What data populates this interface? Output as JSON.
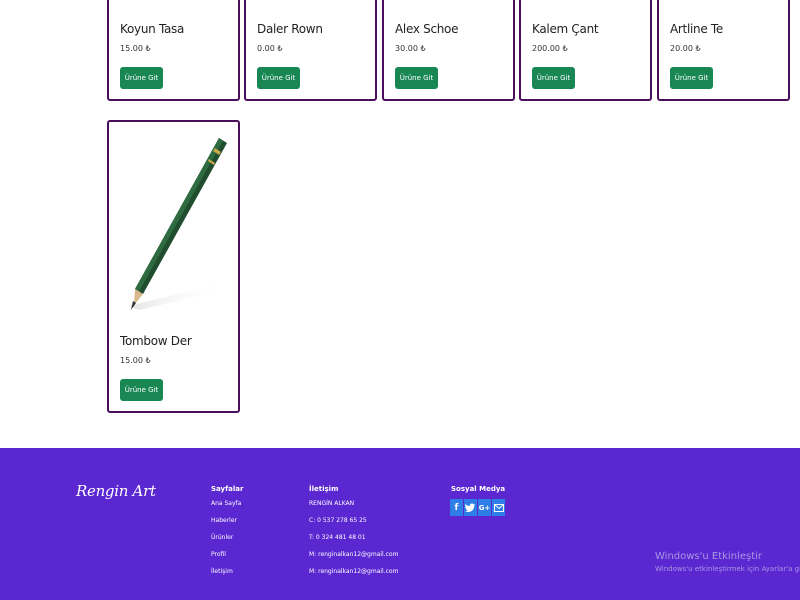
{
  "products": [
    {
      "name": "Koyun Tasa",
      "price": "15.00 ₺",
      "button": "Ürüne Git"
    },
    {
      "name": "Daler Rown",
      "price": "0.00 ₺",
      "button": "Ürüne Git"
    },
    {
      "name": "Alex Schoe",
      "price": "30.00 ₺",
      "button": "Ürüne Git"
    },
    {
      "name": "Kalem Çant",
      "price": "200.00 ₺",
      "button": "Ürüne Git"
    },
    {
      "name": "Artline Te",
      "price": "20.00 ₺",
      "button": "Ürüne Git"
    },
    {
      "name": "Tombow Der",
      "price": "15.00 ₺",
      "button": "Ürüne Git"
    }
  ],
  "footer": {
    "brand": "Rengin Art",
    "pages": {
      "title": "Sayfalar",
      "items": [
        "Ana Sayfa",
        "Haberler",
        "Ürünler",
        "Profil",
        "İletişim"
      ]
    },
    "contact": {
      "title": "İletişim",
      "items": [
        "RENGİN ALKAN",
        "C: 0 537 278 65 25",
        "T: 0 324 481 48 01",
        "M: renginalkan12@gmail.com",
        "M: renginalkan12@gmail.com"
      ]
    },
    "social": {
      "title": "Sosyal Medya",
      "icons": [
        "facebook-icon",
        "twitter-icon",
        "google-plus-icon",
        "mail-icon"
      ]
    },
    "colors": {
      "background": "#5b27d1",
      "social_icon": "#2f7de6",
      "button": "#198754",
      "card_border": "#4a0e5c"
    }
  },
  "windows_activation": {
    "title": "Windows'u Etkinleştir",
    "subtitle": "Windows'u etkinleştirmek için Ayarlar'a gidin."
  }
}
